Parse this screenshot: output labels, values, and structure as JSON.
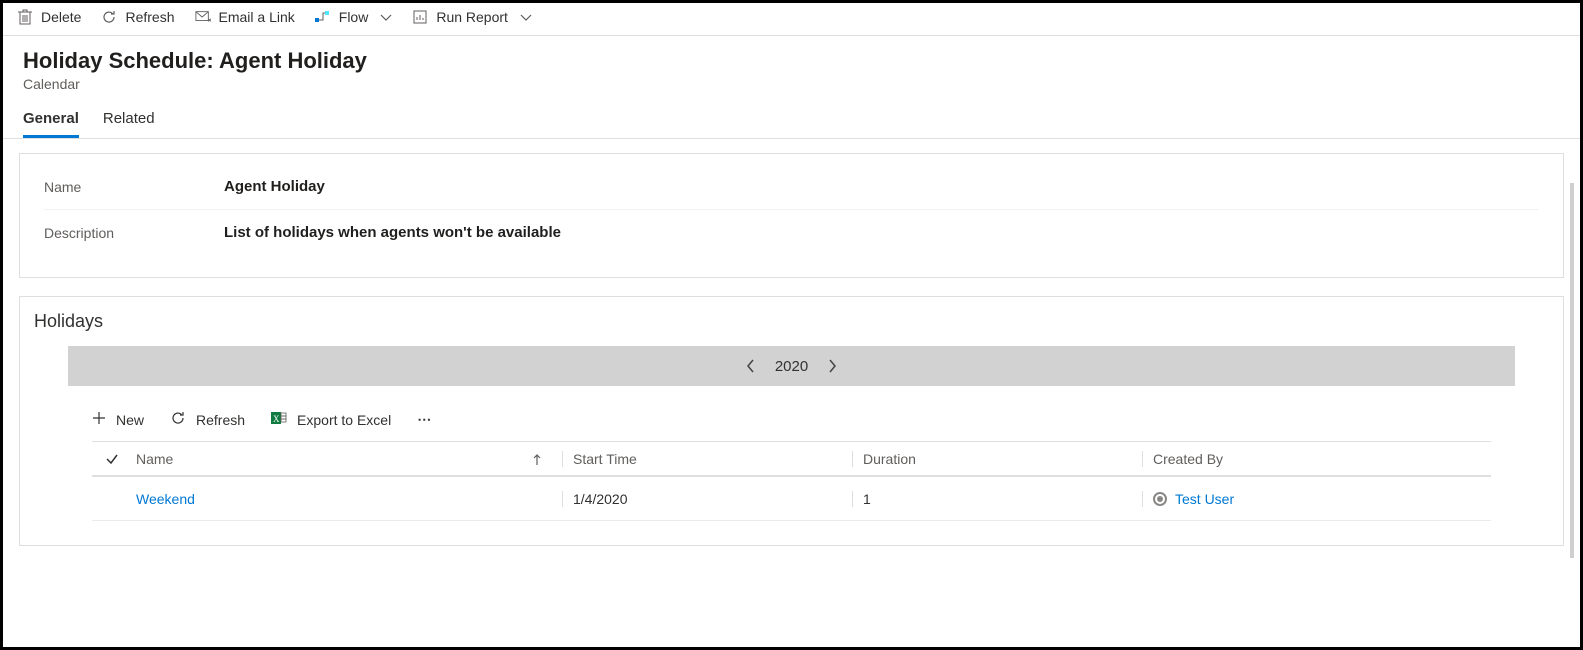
{
  "commandBar": {
    "delete": "Delete",
    "refresh": "Refresh",
    "emailLink": "Email a Link",
    "flow": "Flow",
    "runReport": "Run Report"
  },
  "header": {
    "title": "Holiday Schedule: Agent Holiday",
    "subtitle": "Calendar"
  },
  "tabs": {
    "general": "General",
    "related": "Related"
  },
  "fields": {
    "nameLabel": "Name",
    "nameValue": "Agent Holiday",
    "descLabel": "Description",
    "descValue": "List of holidays when agents won't be available"
  },
  "subgrid": {
    "title": "Holidays",
    "year": "2020",
    "toolbar": {
      "new": "New",
      "refresh": "Refresh",
      "export": "Export to Excel"
    },
    "columns": {
      "name": "Name",
      "start": "Start Time",
      "duration": "Duration",
      "createdBy": "Created By"
    },
    "rows": [
      {
        "name": "Weekend",
        "start": "1/4/2020",
        "duration": "1",
        "createdBy": "Test User"
      }
    ]
  }
}
